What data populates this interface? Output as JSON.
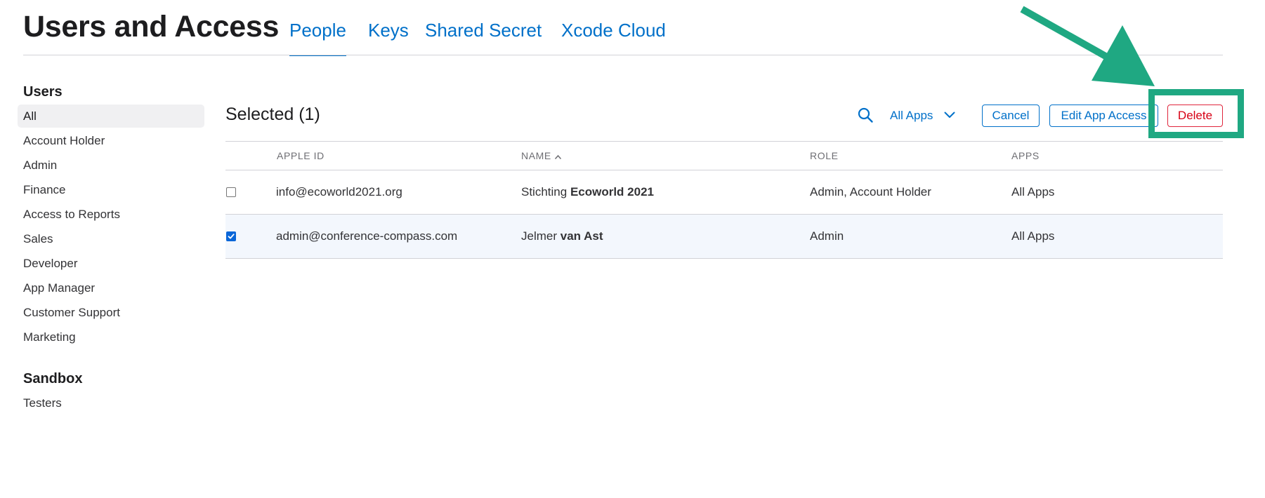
{
  "header": {
    "title": "Users and Access",
    "tabs": [
      {
        "label": "People",
        "active": true
      },
      {
        "label": "Keys",
        "active": false
      },
      {
        "label": "Shared Secret",
        "active": false
      },
      {
        "label": "Xcode Cloud",
        "active": false
      }
    ]
  },
  "sidebar": {
    "users_heading": "Users",
    "users_items": [
      {
        "label": "All",
        "selected": true
      },
      {
        "label": "Account Holder"
      },
      {
        "label": "Admin"
      },
      {
        "label": "Finance"
      },
      {
        "label": "Access to Reports"
      },
      {
        "label": "Sales"
      },
      {
        "label": "Developer"
      },
      {
        "label": "App Manager"
      },
      {
        "label": "Customer Support"
      },
      {
        "label": "Marketing"
      }
    ],
    "sandbox_heading": "Sandbox",
    "sandbox_items": [
      {
        "label": "Testers"
      }
    ]
  },
  "toolbar": {
    "selected_label": "Selected (1)",
    "apps_filter_label": "All Apps",
    "cancel_label": "Cancel",
    "edit_label": "Edit App Access",
    "delete_label": "Delete"
  },
  "table": {
    "columns": [
      "APPLE ID",
      "NAME",
      "ROLE",
      "APPS"
    ],
    "rows": [
      {
        "checked": false,
        "apple_id": "info@ecoworld2021.org",
        "name_first": "Stichting",
        "name_last": "Ecoworld 2021",
        "role": "Admin, Account Holder",
        "apps": "All Apps"
      },
      {
        "checked": true,
        "apple_id": "admin@conference-compass.com",
        "name_first": "Jelmer",
        "name_last": "van Ast",
        "role": "Admin",
        "apps": "All Apps"
      }
    ]
  },
  "colors": {
    "accent": "#0070c9",
    "destructive": "#d70015",
    "annotation": "#1fa882"
  }
}
